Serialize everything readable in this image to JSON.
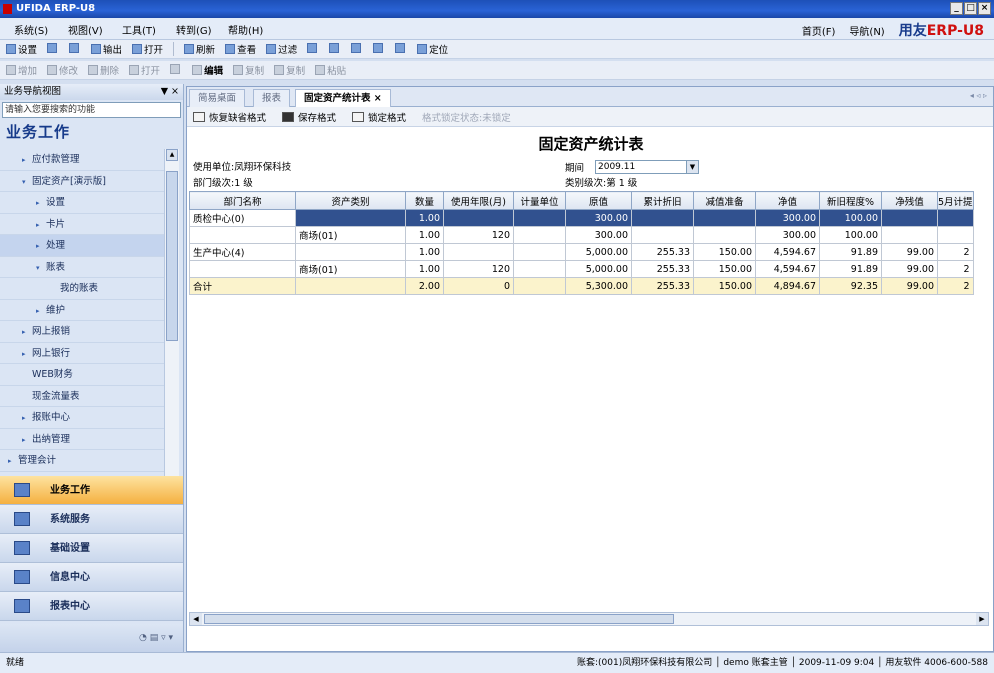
{
  "window": {
    "title": "UFIDA ERP-U8",
    "controls": [
      "_",
      "□",
      "×"
    ]
  },
  "menu": {
    "items": [
      "系统(S)",
      "视图(V)",
      "工具(T)",
      "转到(G)",
      "帮助(H)"
    ],
    "right": {
      "home": "首页(F)",
      "nav": "导航(N)",
      "brand_a": "用友",
      "brand_b": "ERP-U8"
    }
  },
  "toolbar1": [
    "设置",
    "",
    "",
    "输出",
    "打开",
    "刷新",
    "查看",
    "过滤",
    "",
    "",
    "",
    "",
    "",
    "",
    "定位"
  ],
  "toolbar2": [
    "增加",
    "修改",
    "删除",
    "打开",
    "",
    "编辑",
    "复制",
    "复制",
    "粘贴"
  ],
  "sidebar": {
    "header": "业务导航视图",
    "header_ctrl": "▼ ×",
    "search_placeholder": "请输入您要搜索的功能",
    "title": "业务工作",
    "tree": [
      {
        "label": "应付款管理",
        "tri": "▸",
        "indent": 1
      },
      {
        "label": "固定资产[演示版]",
        "tri": "▾",
        "indent": 1
      },
      {
        "label": "设置",
        "tri": "▸",
        "indent": 2
      },
      {
        "label": "卡片",
        "tri": "▸",
        "indent": 2
      },
      {
        "label": "处理",
        "tri": "▸",
        "indent": 2,
        "selected": true
      },
      {
        "label": "账表",
        "tri": "▾",
        "indent": 2
      },
      {
        "label": "我的账表",
        "tri": "",
        "indent": 3
      },
      {
        "label": "维护",
        "tri": "▸",
        "indent": 2
      },
      {
        "label": "网上报销",
        "tri": "▸",
        "indent": 1
      },
      {
        "label": "网上银行",
        "tri": "▸",
        "indent": 1
      },
      {
        "label": "WEB财务",
        "tri": "",
        "indent": 1
      },
      {
        "label": "现金流量表",
        "tri": "",
        "indent": 1
      },
      {
        "label": "报账中心",
        "tri": "▸",
        "indent": 1
      },
      {
        "label": "出纳管理",
        "tri": "▸",
        "indent": 1
      },
      {
        "label": "管理会计",
        "tri": "▸",
        "indent": 0
      }
    ],
    "big_buttons": [
      {
        "label": "业务工作",
        "active": true
      },
      {
        "label": "系统服务",
        "active": false
      },
      {
        "label": "基础设置",
        "active": false
      },
      {
        "label": "信息中心",
        "active": false
      },
      {
        "label": "报表中心",
        "active": false
      }
    ],
    "footer": "◔ ▤ ▿ ▾"
  },
  "tabs": [
    {
      "label": "简易桌面",
      "active": false
    },
    {
      "label": "报表",
      "active": false
    },
    {
      "label": "固定资产统计表 ×",
      "active": true
    }
  ],
  "tabs_nav": "◂ ◃ ▹",
  "content_toolbar": {
    "restore": "恢复缺省格式",
    "save": "保存格式",
    "lock": "锁定格式",
    "status": "格式锁定状态:未锁定"
  },
  "report": {
    "title": "固定资产统计表",
    "unit_label": "使用单位:凤翔环保科技",
    "dept_level": "部门级次:1 级",
    "period_label": "期间",
    "period_value": "2009.11",
    "category_level": "类别级次:第 1 级"
  },
  "table": {
    "columns": [
      "部门名称",
      "资产类别",
      "数量",
      "使用年限(月)",
      "计量单位",
      "原值",
      "累计折旧",
      "减值准备",
      "净值",
      "新旧程度%",
      "净残值",
      "5月计提"
    ],
    "rows": [
      {
        "cells": [
          "质检中心(0)",
          "",
          "1.00",
          "",
          "",
          "300.00",
          "",
          "",
          "300.00",
          "100.00",
          "",
          ""
        ],
        "kind": "sel"
      },
      {
        "cells": [
          "",
          "商场(01)",
          "1.00",
          "120",
          "",
          "300.00",
          "",
          "",
          "300.00",
          "100.00",
          "",
          ""
        ],
        "kind": "normal"
      },
      {
        "cells": [
          "生产中心(4)",
          "",
          "1.00",
          "",
          "",
          "5,000.00",
          "255.33",
          "150.00",
          "4,594.67",
          "91.89",
          "99.00",
          "2"
        ],
        "kind": "normal"
      },
      {
        "cells": [
          "",
          "商场(01)",
          "1.00",
          "120",
          "",
          "5,000.00",
          "255.33",
          "150.00",
          "4,594.67",
          "91.89",
          "99.00",
          "2"
        ],
        "kind": "normal"
      },
      {
        "cells": [
          "合计",
          "",
          "2.00",
          "0",
          "",
          "5,300.00",
          "255.33",
          "150.00",
          "4,894.67",
          "92.35",
          "99.00",
          "2"
        ],
        "kind": "sum"
      }
    ]
  },
  "status": {
    "left": "就绪",
    "right": "账套:(001)凤翔环保科技有限公司 │ demo 账套主管 │ 2009-11-09 9:04 │ 用友软件 4006-600-588"
  }
}
